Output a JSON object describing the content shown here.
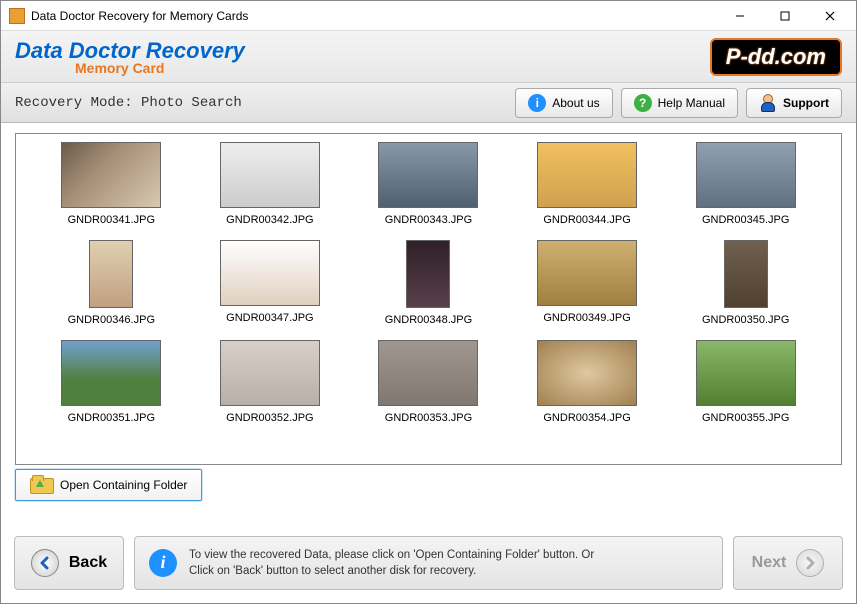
{
  "window": {
    "title": "Data Doctor Recovery for Memory Cards"
  },
  "header": {
    "line1": "Data Doctor Recovery",
    "line2": "Memory Card",
    "badge": "P-dd.com"
  },
  "modebar": {
    "mode": "Recovery Mode: Photo Search",
    "about": "About us",
    "help": "Help Manual",
    "support": "Support"
  },
  "thumbnails": [
    {
      "file": "GNDR00341.JPG",
      "orient": "land",
      "cls": "ph1"
    },
    {
      "file": "GNDR00342.JPG",
      "orient": "land",
      "cls": "ph2"
    },
    {
      "file": "GNDR00343.JPG",
      "orient": "land",
      "cls": "ph3"
    },
    {
      "file": "GNDR00344.JPG",
      "orient": "land",
      "cls": "ph4"
    },
    {
      "file": "GNDR00345.JPG",
      "orient": "land",
      "cls": "ph5"
    },
    {
      "file": "GNDR00346.JPG",
      "orient": "tall",
      "cls": "ph6"
    },
    {
      "file": "GNDR00347.JPG",
      "orient": "land",
      "cls": "ph7"
    },
    {
      "file": "GNDR00348.JPG",
      "orient": "tall",
      "cls": "ph8"
    },
    {
      "file": "GNDR00349.JPG",
      "orient": "land",
      "cls": "ph9"
    },
    {
      "file": "GNDR00350.JPG",
      "orient": "tall",
      "cls": "ph10"
    },
    {
      "file": "GNDR00351.JPG",
      "orient": "land",
      "cls": "ph11"
    },
    {
      "file": "GNDR00352.JPG",
      "orient": "land",
      "cls": "ph12"
    },
    {
      "file": "GNDR00353.JPG",
      "orient": "land",
      "cls": "ph13"
    },
    {
      "file": "GNDR00354.JPG",
      "orient": "land",
      "cls": "ph14"
    },
    {
      "file": "GNDR00355.JPG",
      "orient": "land",
      "cls": "ph15"
    }
  ],
  "open_folder": "Open Containing Folder",
  "footer": {
    "back": "Back",
    "info1": "To view the recovered Data, please click on 'Open Containing Folder' button. Or",
    "info2": "Click on 'Back' button to select another disk for recovery.",
    "next": "Next"
  }
}
